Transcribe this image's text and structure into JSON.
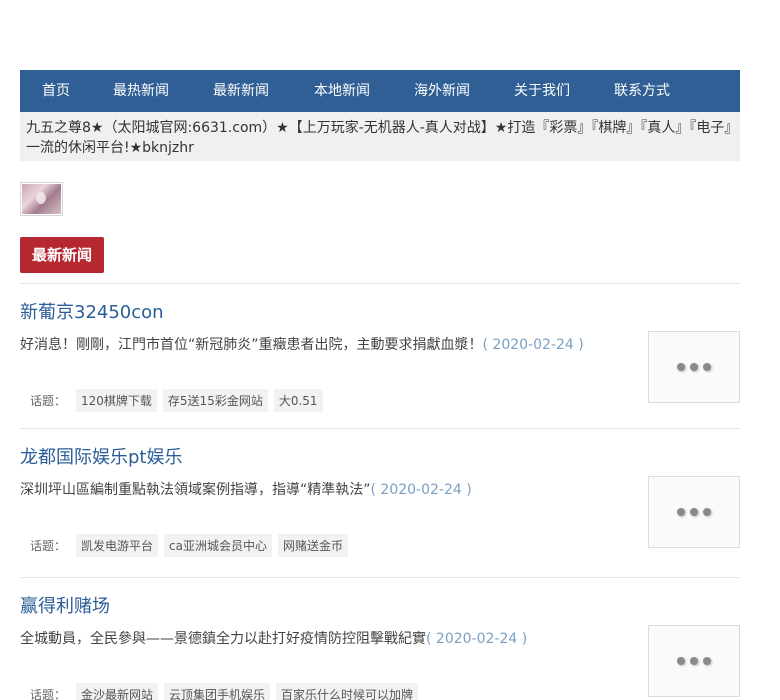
{
  "nav": {
    "items": [
      {
        "label": "首页"
      },
      {
        "label": "最热新闻"
      },
      {
        "label": "最新新闻"
      },
      {
        "label": "本地新闻"
      },
      {
        "label": "海外新闻"
      },
      {
        "label": "关于我们"
      },
      {
        "label": "联系方式"
      }
    ]
  },
  "notice": {
    "text": "九五之尊8★（太阳城官网:6631.com）★【上万玩家-无机器人-真人对战】★打造『彩票』『棋牌』『真人』『电子』一流的休闲平台!★bknjzhr"
  },
  "section": {
    "title": "最新新闻"
  },
  "articles": [
    {
      "title": "新葡京32450con",
      "summary": "好消息！剛剛，江門市首位“新冠肺炎”重癥患者出院，主動要求捐獻血漿！",
      "date": "( 2020-02-24 )",
      "tags_label": "话题：",
      "tags": [
        "120棋牌下载",
        "存5送15彩金网站",
        "大0.51"
      ]
    },
    {
      "title": "龙都国际娱乐pt娱乐",
      "summary": "深圳坪山區編制重點執法領域案例指導，指導“精準執法”",
      "date": "( 2020-02-24 )",
      "tags_label": "话题：",
      "tags": [
        "凯发电游平台",
        "ca亚洲城会员中心",
        "网赌送金币"
      ]
    },
    {
      "title": "赢得利赌场",
      "summary": "全城動員，全民參與——景德鎮全力以赴打好疫情防控阻擊戰紀實",
      "date": "( 2020-02-24 )",
      "tags_label": "话题：",
      "tags": [
        "金沙最新网站",
        "云顶集团手机娱乐",
        "百家乐什么时候可以加牌"
      ]
    }
  ]
}
